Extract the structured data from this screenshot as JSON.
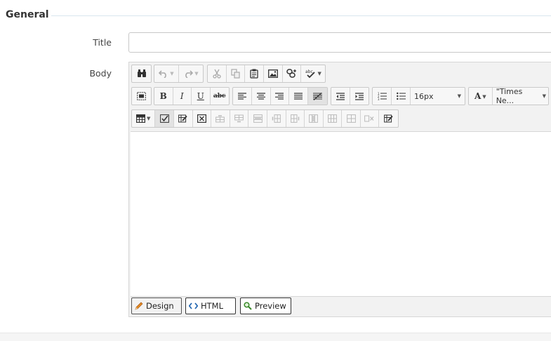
{
  "section": {
    "title": "General"
  },
  "form": {
    "title_label": "Title",
    "title_value": "",
    "body_label": "Body"
  },
  "editor": {
    "font_size": "16px",
    "font_name": "\"Times Ne...",
    "text_color_icon": "A",
    "modes": [
      {
        "label": "Design",
        "icon": "pencil-icon",
        "active": true
      },
      {
        "label": "HTML",
        "icon": "code-icon",
        "active": false
      },
      {
        "label": "Preview",
        "icon": "magnifier-icon",
        "active": false
      }
    ]
  }
}
